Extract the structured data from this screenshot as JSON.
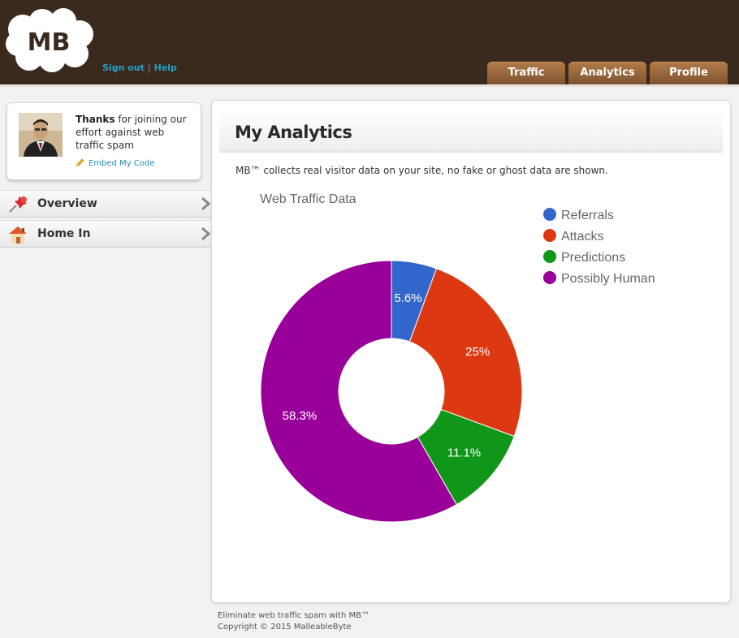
{
  "header": {
    "logo_text": "MB",
    "links": {
      "sign_out": "Sign out",
      "separator": "|",
      "help": "Help"
    },
    "tabs": [
      {
        "label": "Traffic"
      },
      {
        "label": "Analytics"
      },
      {
        "label": "Profile"
      }
    ]
  },
  "sidebar": {
    "profile": {
      "welcome_bold": "Thanks",
      "welcome_rest": " for joining our effort against web traffic spam",
      "embed_label": "Embed My Code"
    },
    "nav": [
      {
        "label": "Overview",
        "icon": "pushpin-icon"
      },
      {
        "label": "Home In",
        "icon": "house-icon"
      }
    ]
  },
  "main": {
    "title": "My Analytics",
    "intro": "MB™ collects real visitor data on your site, no fake or ghost data are shown."
  },
  "chart_data": {
    "type": "pie",
    "title": "Web Traffic Data",
    "donut": true,
    "legend_position": "top-right",
    "slices": [
      {
        "label": "Referrals",
        "value": 5.6,
        "display": "5.6%",
        "color": "#3366cc"
      },
      {
        "label": "Attacks",
        "value": 25,
        "display": "25%",
        "color": "#dc3912"
      },
      {
        "label": "Predictions",
        "value": 11.1,
        "display": "11.1%",
        "color": "#109618"
      },
      {
        "label": "Possibly Human",
        "value": 58.3,
        "display": "58.3%",
        "color": "#990099"
      }
    ]
  },
  "footer": {
    "line1": "Eliminate web traffic spam with MB™",
    "line2": "Copyright © 2015 MalleableByte"
  },
  "colors": {
    "header_bg": "#3a2a1e",
    "link": "#25a0c8",
    "tab": "#8a5c36"
  }
}
